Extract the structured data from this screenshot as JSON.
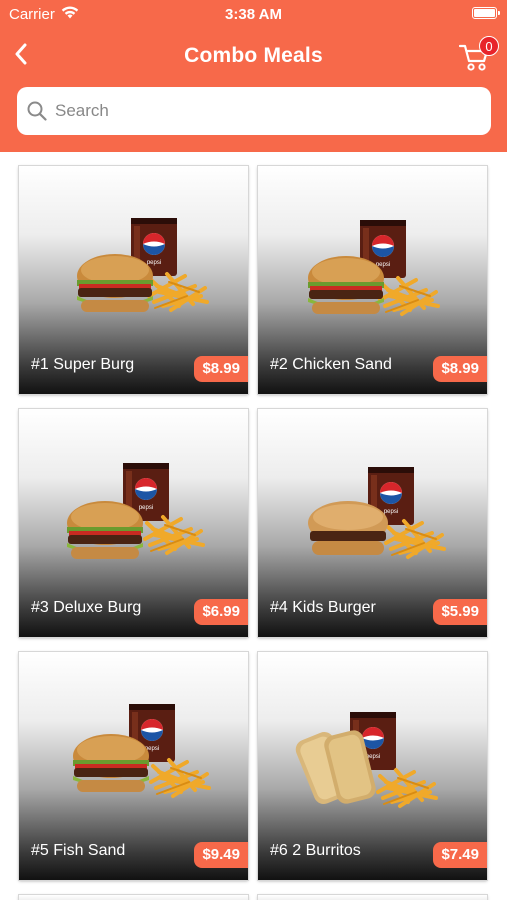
{
  "status_bar": {
    "carrier": "Carrier",
    "time": "3:38 AM"
  },
  "nav": {
    "title": "Combo Meals",
    "cart_count": "0"
  },
  "search": {
    "placeholder": "Search"
  },
  "colors": {
    "accent": "#f7694a",
    "badge": "#e8242a"
  },
  "products": [
    {
      "name": "#1 Super Burg",
      "price": "$8.99",
      "icon": "burger-combo-image"
    },
    {
      "name": "#2 Chicken Sand",
      "price": "$8.99",
      "icon": "chicken-sandwich-combo-image"
    },
    {
      "name": "#3 Deluxe Burg",
      "price": "$6.99",
      "icon": "deluxe-burger-combo-image"
    },
    {
      "name": "#4 Kids Burger",
      "price": "$5.99",
      "icon": "kids-burger-combo-image"
    },
    {
      "name": "#5 Fish Sand",
      "price": "$9.49",
      "icon": "fish-sandwich-combo-image"
    },
    {
      "name": "#6 2 Burritos",
      "price": "$7.49",
      "icon": "burritos-combo-image"
    }
  ]
}
